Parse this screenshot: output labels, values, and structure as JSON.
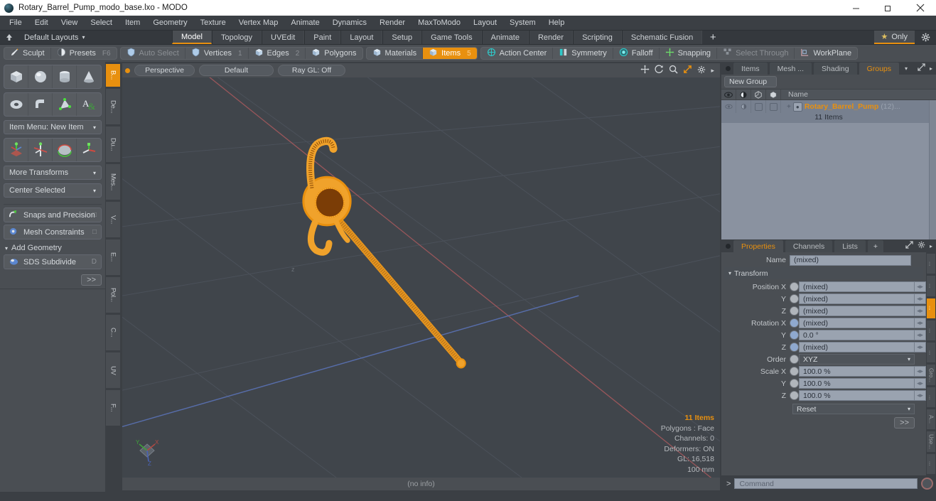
{
  "window": {
    "title": "Rotary_Barrel_Pump_modo_base.lxo - MODO",
    "minimize": "−",
    "maximize": "❐",
    "close": "✕"
  },
  "menubar": [
    "File",
    "Edit",
    "View",
    "Select",
    "Item",
    "Geometry",
    "Texture",
    "Vertex Map",
    "Animate",
    "Dynamics",
    "Render",
    "MaxToModo",
    "Layout",
    "System",
    "Help"
  ],
  "layoutbar": {
    "default_layouts": "Default Layouts",
    "caret": "▾",
    "tabs": [
      {
        "label": "Model",
        "active": true
      },
      {
        "label": "Topology",
        "active": false
      },
      {
        "label": "UVEdit",
        "active": false
      },
      {
        "label": "Paint",
        "active": false
      },
      {
        "label": "Layout",
        "active": false
      },
      {
        "label": "Setup",
        "active": false
      },
      {
        "label": "Game Tools",
        "active": false
      },
      {
        "label": "Animate",
        "active": false
      },
      {
        "label": "Render",
        "active": false
      },
      {
        "label": "Scripting",
        "active": false
      },
      {
        "label": "Schematic Fusion",
        "active": false
      }
    ],
    "add": "+",
    "only": "Only",
    "star": "★"
  },
  "modebar": {
    "group1": [
      {
        "label": "Sculpt",
        "icon": "brush-icon",
        "num": "",
        "state": "normal"
      },
      {
        "label": "Presets",
        "icon": "sphere-icon",
        "num": "F6",
        "state": "normal"
      }
    ],
    "group2": [
      {
        "label": "Auto Select",
        "icon": "shield-icon",
        "num": "",
        "state": "dim"
      },
      {
        "label": "Vertices",
        "icon": "shield-icon",
        "num": "1",
        "state": "normal"
      },
      {
        "label": "Edges",
        "icon": "cube-icon",
        "num": "2",
        "state": "normal"
      },
      {
        "label": "Polygons",
        "icon": "cube-icon",
        "num": "",
        "state": "normal"
      }
    ],
    "group3": [
      {
        "label": "Materials",
        "icon": "cube-icon",
        "num": "",
        "state": "normal"
      },
      {
        "label": "Items",
        "icon": "cube-icon",
        "num": "5",
        "state": "selected"
      }
    ],
    "group4": [
      {
        "label": "Action Center",
        "icon": "target-icon",
        "num": "",
        "state": "normal"
      },
      {
        "label": "Symmetry",
        "icon": "symmetry-icon",
        "num": "",
        "state": "normal"
      },
      {
        "label": "Falloff",
        "icon": "falloff-icon",
        "num": "",
        "state": "normal"
      },
      {
        "label": "Snapping",
        "icon": "snap-icon",
        "num": "",
        "state": "normal"
      },
      {
        "label": "Select Through",
        "icon": "select-through-icon",
        "num": "",
        "state": "dim"
      },
      {
        "label": "WorkPlane",
        "icon": "workplane-icon",
        "num": "",
        "state": "normal"
      }
    ]
  },
  "toolpanel": {
    "primitives_row1": [
      "cube-icon",
      "sphere-icon",
      "cylinder-icon",
      "cone-icon"
    ],
    "primitives_row2": [
      "torus-icon",
      "tube-icon",
      "mesh-icon",
      "text-icon"
    ],
    "item_menu": "Item Menu: New Item",
    "transform_icons": [
      "move-tool-icon",
      "rotate-tool-icon",
      "scale-tool-icon",
      "transform-tool-icon"
    ],
    "more_transforms": "More Transforms",
    "center_selected": "Center Selected",
    "snaps": "Snaps and Precision",
    "mesh_constraints": "Mesh Constraints",
    "add_geometry": "Add Geometry",
    "sds_subdivide": "SDS Subdivide",
    "sds_key": "D",
    "more": ">>",
    "caret": "▾"
  },
  "left_vtabs": [
    {
      "label": "B...",
      "active": true
    },
    {
      "label": "De...",
      "active": false
    },
    {
      "label": "Du...",
      "active": false
    },
    {
      "label": "Mes...",
      "active": false
    },
    {
      "label": "V...",
      "active": false
    },
    {
      "label": "E...",
      "active": false
    },
    {
      "label": "Pol...",
      "active": false
    },
    {
      "label": "C...",
      "active": false
    },
    {
      "label": "UV",
      "active": false
    },
    {
      "label": "F...",
      "active": false
    }
  ],
  "viewport": {
    "perspective": "Perspective",
    "shading": "Default",
    "raygl": "Ray GL: Off",
    "icons": [
      "pan-icon",
      "rotate-icon",
      "zoom-icon",
      "fit-icon",
      "gear-icon",
      "chevron-right-icon"
    ],
    "stats": {
      "items": "11 Items",
      "polygons": "Polygons : Face",
      "channels": "Channels: 0",
      "deformers": "Deformers: ON",
      "gl": "GL: 16,518",
      "scale": "100 mm"
    },
    "status": "(no info)"
  },
  "groups_panel": {
    "tabs": [
      {
        "label": "Items",
        "active": false
      },
      {
        "label": "Mesh ...",
        "active": false
      },
      {
        "label": "Shading",
        "active": false
      },
      {
        "label": "Groups",
        "active": true
      }
    ],
    "caret": "▾",
    "expand_icon": "expand-icon",
    "chevron": "▸",
    "new_group": "New Group",
    "columns": [
      "eye-icon",
      "render-icon",
      "shade-icon",
      "wire-icon"
    ],
    "name_header": "Name",
    "row": {
      "name": "Rotary_Barrel_Pump",
      "count": "(12)...",
      "sub": "11 Items",
      "plus": "+"
    }
  },
  "properties_panel": {
    "tabs": [
      {
        "label": "Properties",
        "active": true
      },
      {
        "label": "Channels",
        "active": false
      },
      {
        "label": "Lists",
        "active": false
      },
      {
        "label": "+",
        "active": false
      }
    ],
    "name_label": "Name",
    "name_value": "(mixed)",
    "transform_header": "Transform",
    "rows": [
      {
        "label": "Position X",
        "value": "(mixed)",
        "knob": "white"
      },
      {
        "label": "Y",
        "value": "(mixed)",
        "knob": "white"
      },
      {
        "label": "Z",
        "value": "(mixed)",
        "knob": "white"
      },
      {
        "label": "Rotation X",
        "value": "(mixed)",
        "knob": "blue"
      },
      {
        "label": "Y",
        "value": "0.0 °",
        "knob": "blue"
      },
      {
        "label": "Z",
        "value": "(mixed)",
        "knob": "blue"
      }
    ],
    "order_label": "Order",
    "order_value": "XYZ",
    "scale_rows": [
      {
        "label": "Scale X",
        "value": "100.0 %",
        "knob": "white"
      },
      {
        "label": "Y",
        "value": "100.0 %",
        "knob": "white"
      },
      {
        "label": "Z",
        "value": "100.0 %",
        "knob": "white"
      }
    ],
    "reset": "Reset",
    "more": ">>",
    "caret": "▾"
  },
  "right_vtabs_top": [
    {
      "label": "",
      "active": false
    }
  ],
  "right_vtabs": [
    {
      "label": "...",
      "active": false
    },
    {
      "label": "...",
      "active": false
    },
    {
      "label": "...",
      "active": true
    },
    {
      "label": "...",
      "active": false
    },
    {
      "label": "...",
      "active": false
    },
    {
      "label": "Gro...",
      "active": false
    },
    {
      "label": "...",
      "active": false
    },
    {
      "label": "A...",
      "active": false
    },
    {
      "label": "Use...",
      "active": false
    },
    {
      "label": "...",
      "active": false
    }
  ],
  "command_bar": {
    "prompt": ">",
    "placeholder": "Command",
    "record": "record-icon"
  },
  "colors": {
    "accent": "#e8900f",
    "panel": "#4a4e53",
    "viewport_bg": "#40454b",
    "tree_bg": "#8a92a0",
    "field_bg": "#9aa3b0"
  }
}
